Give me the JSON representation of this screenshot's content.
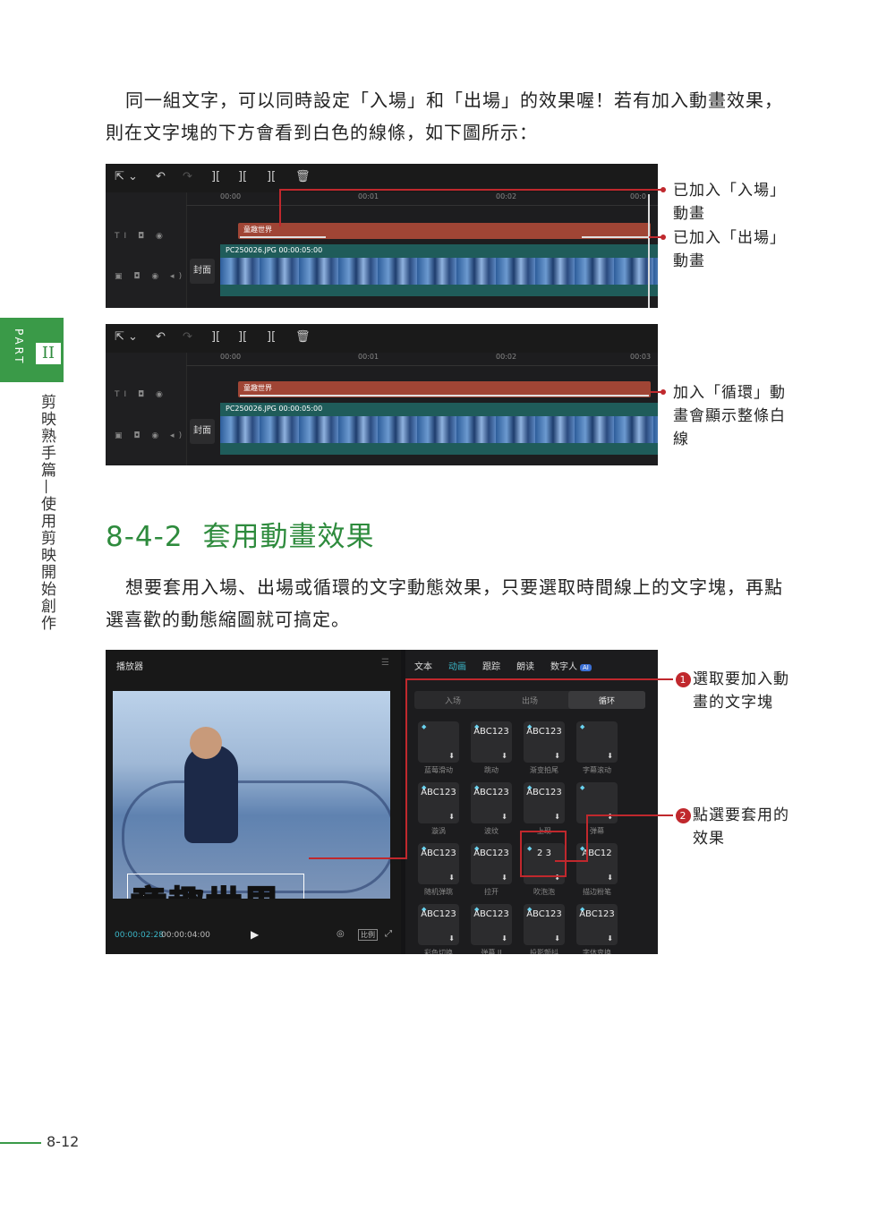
{
  "intro": {
    "line1": "同一組文字，可以同時設定「入場」和「出場」的效果喔！若有加入動畫效果，",
    "line2": "則在文字塊的下方會看到白色的線條，如下圖所示："
  },
  "fig1": {
    "ticks": [
      "00:00",
      "00:01",
      "00:02",
      "00:0"
    ],
    "text_clip": "童趣世界",
    "video_clip": "PC250026.JPG  00:00:05:00",
    "cover": "封面",
    "callout_in_1": "已加入「入場」",
    "callout_in_2": "動畫",
    "callout_out_1": "已加入「出場」",
    "callout_out_2": "動畫"
  },
  "fig2": {
    "ticks": [
      "00:00",
      "00:01",
      "00:02",
      "00:03"
    ],
    "text_clip": "童趣世界",
    "video_clip": "PC250026.JPG  00:00:05:00",
    "cover": "封面",
    "callout_1": "加入「循環」動",
    "callout_2": "畫會顯示整條白",
    "callout_3": "線"
  },
  "section": {
    "number": "8-4-2",
    "title": "套用動畫效果"
  },
  "body2": {
    "line1": "想要套用入場、出場或循環的文字動態效果，只要選取時間線上的文字塊，再點",
    "line2": "選喜歡的動態縮圖就可搞定。"
  },
  "editor": {
    "player_title": "播放器",
    "subtitle_text": "童趣世界",
    "time_current": "00:00:02:28",
    "time_total": "00:00:04:00",
    "ratio": "比例",
    "tabs": [
      "文本",
      "动画",
      "跟踪",
      "朗读",
      "数字人"
    ],
    "ai_badge": "AI",
    "segments": [
      "入场",
      "出场",
      "循环"
    ],
    "effects": [
      {
        "thumb": "",
        "caption": "蓝莓滑动"
      },
      {
        "thumb": "ABC123",
        "caption": "跳动"
      },
      {
        "thumb": "ABC123",
        "caption": "渐变拍尾"
      },
      {
        "thumb": "",
        "caption": "字幕滚动"
      },
      {
        "thumb": "ABC123",
        "caption": "漩涡"
      },
      {
        "thumb": "ABC123",
        "caption": "波纹"
      },
      {
        "thumb": "ABC123",
        "caption": "上现"
      },
      {
        "thumb": "",
        "caption": "弹幕"
      },
      {
        "thumb": "ABC123",
        "caption": "随机弹跳"
      },
      {
        "thumb": "ABC123",
        "caption": "拉开"
      },
      {
        "thumb": "2 3",
        "caption": "吹泡泡"
      },
      {
        "thumb": "ABC12",
        "caption": "描边粉笔"
      },
      {
        "thumb": "ABC123",
        "caption": "彩色切换"
      },
      {
        "thumb": "ABC123",
        "caption": "弹幕 II"
      },
      {
        "thumb": "ABC123",
        "caption": "投影颤抖"
      },
      {
        "thumb": "ABC123",
        "caption": "字体变换"
      }
    ]
  },
  "callouts": {
    "c1_num": "1",
    "c1_line1": "選取要加入動",
    "c1_line2": "畫的文字塊",
    "c2_num": "2",
    "c2_line1": "點選要套用的",
    "c2_line2": "效果"
  },
  "sidebar": {
    "part": "PART",
    "roman": "II",
    "title": "剪映熟手篇—使用剪映開始創作"
  },
  "page_number": "8-12",
  "colors": {
    "accent_green": "#3a9a48",
    "callout_red": "#c0282d",
    "clip_red": "#a04535",
    "highlight_cyan": "#3bb7c9"
  }
}
